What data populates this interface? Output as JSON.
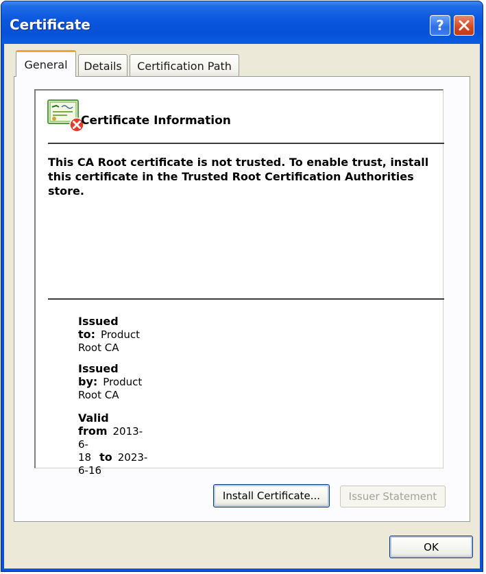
{
  "window": {
    "title": "Certificate"
  },
  "titlebar": {
    "help_label": "?",
    "close_label": "×"
  },
  "tabs": [
    {
      "label": "General",
      "selected": true
    },
    {
      "label": "Details",
      "selected": false
    },
    {
      "label": "Certification Path",
      "selected": false
    }
  ],
  "info": {
    "title": "Certificate Information",
    "icon": "certificate-untrusted-icon",
    "warning": "This CA Root certificate is not trusted. To enable trust, install this certificate in the Trusted Root Certification Authorities store."
  },
  "details": {
    "issued_to_label": "Issued to:",
    "issued_to_value": "Product Root CA",
    "issued_by_label": "Issued by:",
    "issued_by_value": "Product Root CA",
    "valid_from_label": "Valid from",
    "valid_from_value": "2013-6-18",
    "valid_to_label": "to",
    "valid_to_value": "2023-6-16"
  },
  "buttons": {
    "install": "Install Certificate...",
    "issuer_statement": "Issuer Statement",
    "ok": "OK"
  },
  "colors": {
    "titlebar_blue": "#0a56dd",
    "dialog_bg": "#ece9d8",
    "tab_highlight": "#f7a325",
    "close_red": "#d44721",
    "disabled_text": "#a2a293"
  }
}
